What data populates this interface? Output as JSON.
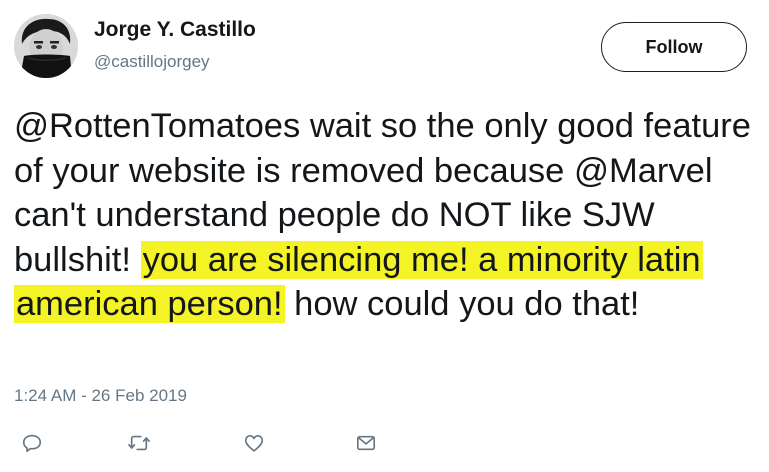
{
  "author": {
    "display_name": "Jorge Y. Castillo",
    "handle": "@castillojorgey",
    "avatar_icon": "user-avatar"
  },
  "follow_label": "Follow",
  "tweet": {
    "text_plain_1": "@RottenTomatoes wait so the only good feature of your website is removed because @Marvel can't understand people do NOT like SJW bullshit! ",
    "text_highlighted": "you are silencing me! a minority latin american person!",
    "text_plain_2": " how could you do that!",
    "highlight_color": "#f4f326"
  },
  "timestamp": "1:24 AM - 26 Feb 2019",
  "actions": [
    {
      "icon": "reply-icon"
    },
    {
      "icon": "retweet-icon"
    },
    {
      "icon": "like-icon"
    },
    {
      "icon": "message-icon"
    }
  ],
  "colors": {
    "text": "#14171a",
    "secondary_text": "#657786",
    "icon": "#657786"
  }
}
